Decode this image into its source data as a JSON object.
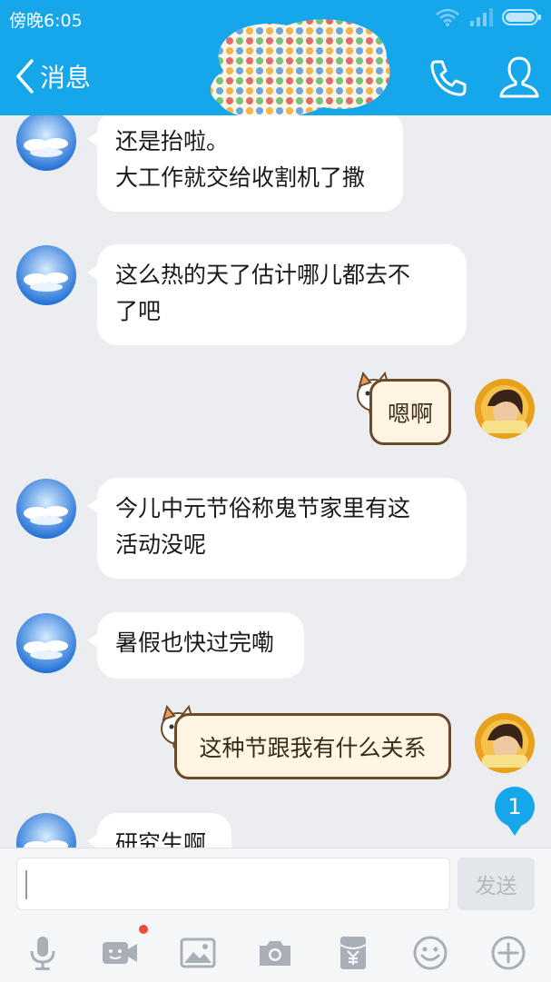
{
  "status_bar": {
    "time": "傍晚6:05"
  },
  "nav": {
    "back_label": "消息"
  },
  "messages": [
    {
      "side": "left",
      "lines": [
        "还是抬啦。",
        "大工作就交给收割机了撒"
      ]
    },
    {
      "side": "left",
      "lines": [
        "这么热的天了估计哪儿都去不",
        "了吧"
      ]
    },
    {
      "side": "right",
      "text": "嗯啊"
    },
    {
      "side": "left",
      "lines": [
        "今儿中元节俗称鬼节家里有这",
        "活动没呢"
      ]
    },
    {
      "side": "left",
      "lines": [
        "暑假也快过完嘞"
      ]
    },
    {
      "side": "right",
      "text": "这种节跟我有什么关系"
    },
    {
      "side": "left",
      "lines": [
        "研究生啊"
      ]
    }
  ],
  "unread_badge": "1",
  "input": {
    "value": "",
    "send_label": "发送"
  },
  "toolbar": [
    "mic-icon",
    "video-call-icon",
    "image-icon",
    "camera-icon",
    "red-packet-icon",
    "emoji-icon",
    "plus-icon"
  ],
  "colors": {
    "accent": "#16a6ea",
    "chat_bg": "#ebedf0",
    "bubble": "#ffffff",
    "badge_dot": "#f04a3b"
  }
}
